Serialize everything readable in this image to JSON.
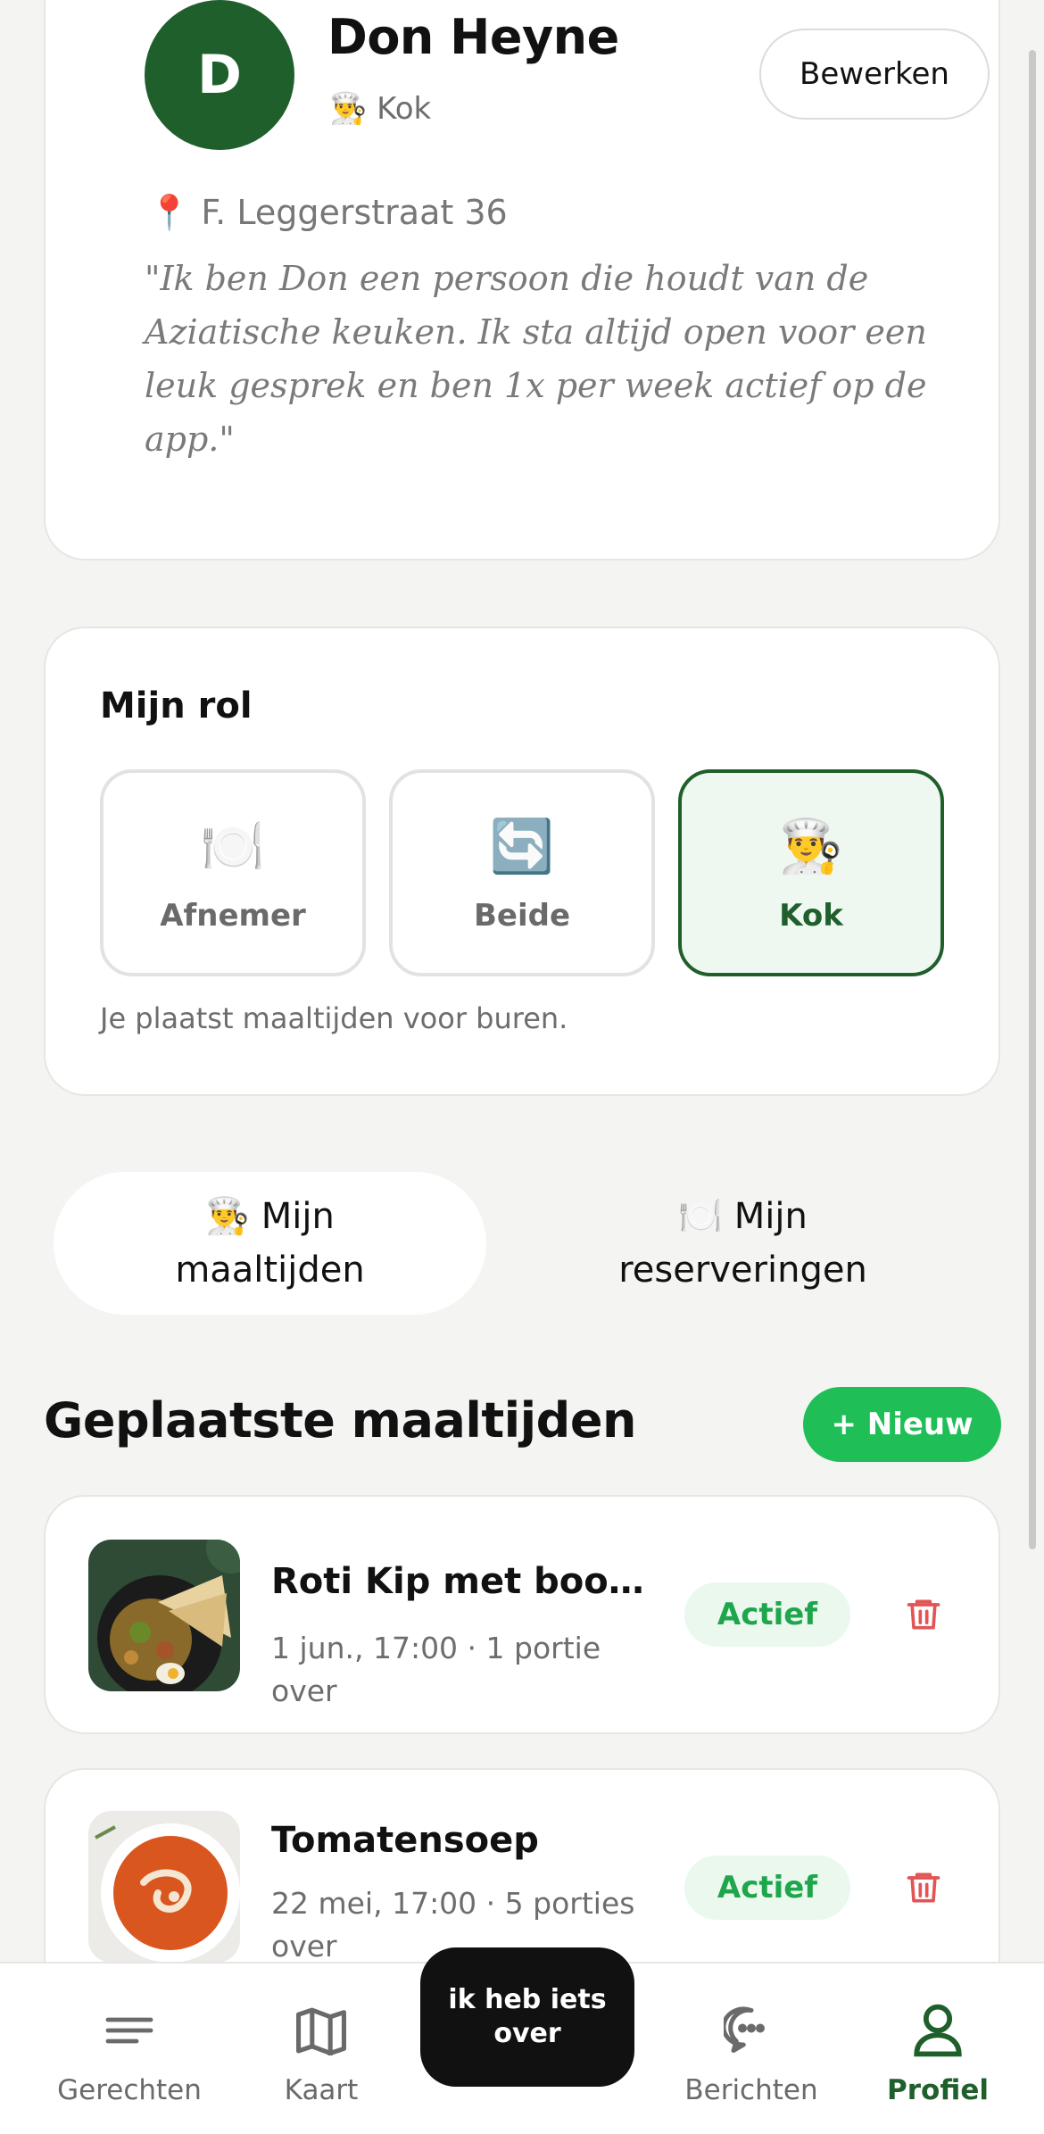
{
  "profile": {
    "avatar_initial": "D",
    "name": "Don Heyne",
    "role_emoji": "👨‍🍳",
    "role": "Kok",
    "edit_label": "Bewerken",
    "address_emoji": "📍",
    "address": "F. Leggerstraat 36",
    "bio": "\"Ik ben Don een persoon die houdt van de Aziatische keuken. Ik sta altijd open voor een leuk gesprek en ben 1x per week actief op de app.\""
  },
  "role_section": {
    "title": "Mijn rol",
    "options": [
      {
        "icon": "🍽️",
        "label": "Afnemer"
      },
      {
        "icon": "🔄",
        "label": "Beide"
      },
      {
        "icon": "👨‍🍳",
        "label": "Kok"
      }
    ],
    "selected": "Kok",
    "description": "Je plaatst maaltijden voor buren."
  },
  "tabs": [
    {
      "line1": "👨‍🍳 Mijn",
      "line2": "maaltijden",
      "active": true
    },
    {
      "line1": "🍽️ Mijn",
      "line2": "reserveringen",
      "active": false
    }
  ],
  "meals_section": {
    "title": "Geplaatste maaltijden",
    "new_label": "+ Nieuw"
  },
  "meals": [
    {
      "title": "Roti Kip met boont…",
      "meta": "1 jun., 17:00 · 1 portie over",
      "status": "Actief"
    },
    {
      "title": "Tomatensoep",
      "meta": "22 mei, 17:00 · 5 porties over",
      "status": "Actief"
    }
  ],
  "nav": {
    "items": [
      {
        "label": "Gerechten",
        "icon": "menu-lines-icon"
      },
      {
        "label": "Kaart",
        "icon": "map-icon"
      },
      {
        "label": "Berichten",
        "icon": "chat-bubble-icon"
      },
      {
        "label": "Profiel",
        "icon": "user-icon"
      }
    ],
    "center_label": "ik heb iets over",
    "active": "Profiel"
  },
  "colors": {
    "brand_dark_green": "#1f5f2c",
    "accent_green": "#1fbe57",
    "status_text": "#1fa64c",
    "trash_red": "#e25555"
  }
}
